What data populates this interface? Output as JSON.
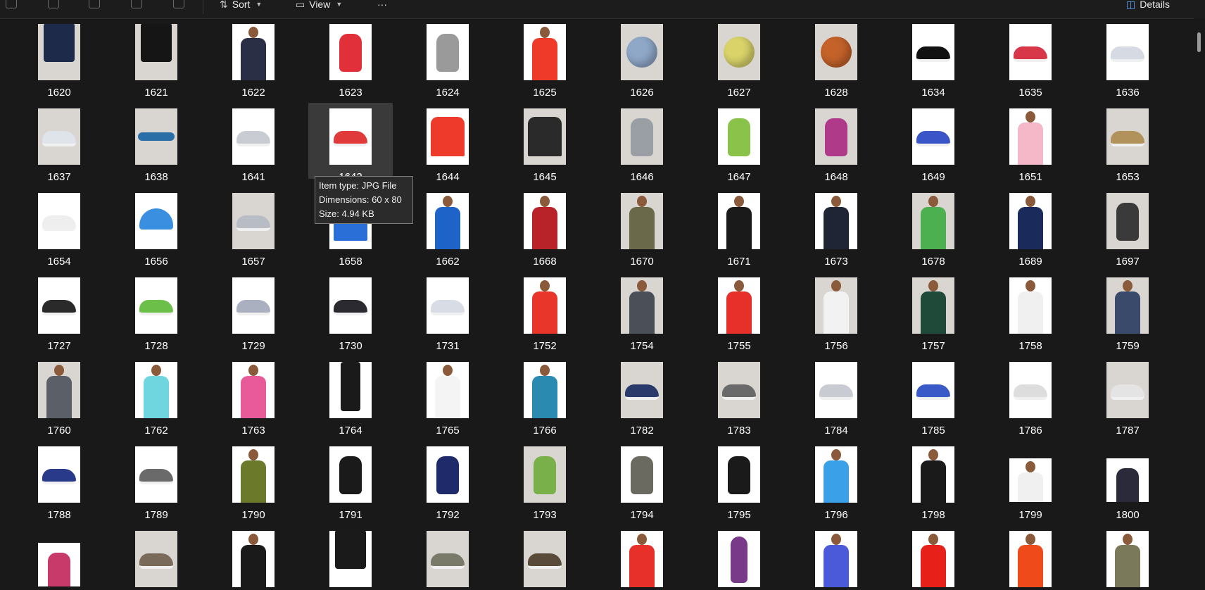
{
  "toolbar": {
    "icons": [
      "copy-icon",
      "paste-icon",
      "rename-icon",
      "share-icon",
      "delete-icon"
    ],
    "sort_label": "Sort",
    "view_label": "View",
    "more_label": "···",
    "details_label": "Details"
  },
  "tooltip": {
    "line1": "Item type: JPG File",
    "line2": "Dimensions: 60 x 80",
    "line3": "Size: 4.94 KB"
  },
  "files": [
    {
      "name": "1620",
      "kind": "shorts",
      "color": "#1d2a4a",
      "bg": "gray"
    },
    {
      "name": "1621",
      "kind": "shorts",
      "color": "#151515",
      "bg": "gray"
    },
    {
      "name": "1622",
      "kind": "person",
      "color": "#2b2f45",
      "bg": "white"
    },
    {
      "name": "1623",
      "kind": "bag",
      "color": "#e2303a",
      "bg": "white"
    },
    {
      "name": "1624",
      "kind": "bag",
      "color": "#9a9a9a",
      "bg": "white"
    },
    {
      "name": "1625",
      "kind": "person",
      "color": "#ef3a2a",
      "bg": "white"
    },
    {
      "name": "1626",
      "kind": "ball",
      "color": "#8fa8c8",
      "bg": "gray"
    },
    {
      "name": "1627",
      "kind": "ball",
      "color": "#d9d36a",
      "bg": "gray"
    },
    {
      "name": "1628",
      "kind": "ball",
      "color": "#c4622a",
      "bg": "gray"
    },
    {
      "name": "1634",
      "kind": "shoe",
      "color": "#111111",
      "bg": "white"
    },
    {
      "name": "1635",
      "kind": "shoe",
      "color": "#d8374a",
      "bg": "white"
    },
    {
      "name": "1636",
      "kind": "shoe",
      "color": "#d6dbe3",
      "bg": "white"
    },
    {
      "name": "1637",
      "kind": "shoe",
      "color": "#dfe3ea",
      "bg": "gray"
    },
    {
      "name": "1638",
      "kind": "goggles",
      "color": "#2a6ea8",
      "bg": "gray"
    },
    {
      "name": "1641",
      "kind": "shoe",
      "color": "#c9ccd2",
      "bg": "white"
    },
    {
      "name": "1642",
      "kind": "shoe",
      "color": "#e03a3a",
      "bg": "white"
    },
    {
      "name": "1644",
      "kind": "tee",
      "color": "#ee3a2a",
      "bg": "white"
    },
    {
      "name": "1645",
      "kind": "tee",
      "color": "#2a2a2a",
      "bg": "gray"
    },
    {
      "name": "1646",
      "kind": "bag",
      "color": "#9a9fa6",
      "bg": "gray"
    },
    {
      "name": "1647",
      "kind": "bag",
      "color": "#8bc34a",
      "bg": "white"
    },
    {
      "name": "1648",
      "kind": "bag",
      "color": "#b03a8a",
      "bg": "gray"
    },
    {
      "name": "1649",
      "kind": "shoe",
      "color": "#3a55c8",
      "bg": "white"
    },
    {
      "name": "1651",
      "kind": "person",
      "color": "#f4b8c8",
      "bg": "white"
    },
    {
      "name": "1653",
      "kind": "shoe",
      "color": "#b0925a",
      "bg": "gray"
    },
    {
      "name": "1654",
      "kind": "shoe",
      "color": "#eeeeee",
      "bg": "white"
    },
    {
      "name": "1656",
      "kind": "cap",
      "color": "#3a8fe0",
      "bg": "white"
    },
    {
      "name": "1657",
      "kind": "shoe",
      "color": "#b8bcc4",
      "bg": "gray"
    },
    {
      "name": "1658",
      "kind": "jacket",
      "color": "#2a6ed8",
      "bg": "white"
    },
    {
      "name": "1662",
      "kind": "person",
      "color": "#1e64c8",
      "bg": "white"
    },
    {
      "name": "1668",
      "kind": "person",
      "color": "#b8232a",
      "bg": "white"
    },
    {
      "name": "1670",
      "kind": "person",
      "color": "#6a6a4a",
      "bg": "gray"
    },
    {
      "name": "1671",
      "kind": "person",
      "color": "#1a1a1a",
      "bg": "white"
    },
    {
      "name": "1673",
      "kind": "person",
      "color": "#1f2535",
      "bg": "white"
    },
    {
      "name": "1678",
      "kind": "person",
      "color": "#4caf50",
      "bg": "gray"
    },
    {
      "name": "1689",
      "kind": "person",
      "color": "#1a2a5a",
      "bg": "white"
    },
    {
      "name": "1697",
      "kind": "bag",
      "color": "#3a3a3a",
      "bg": "gray"
    },
    {
      "name": "1727",
      "kind": "shoe",
      "color": "#2a2a2a",
      "bg": "white"
    },
    {
      "name": "1728",
      "kind": "shoe",
      "color": "#6cc04a",
      "bg": "white"
    },
    {
      "name": "1729",
      "kind": "shoe",
      "color": "#aab0c0",
      "bg": "white"
    },
    {
      "name": "1730",
      "kind": "shoe",
      "color": "#2a2a30",
      "bg": "white"
    },
    {
      "name": "1731",
      "kind": "shoe",
      "color": "#d8dde5",
      "bg": "white"
    },
    {
      "name": "1752",
      "kind": "person",
      "color": "#e8362a",
      "bg": "white"
    },
    {
      "name": "1754",
      "kind": "person",
      "color": "#4a4f58",
      "bg": "gray"
    },
    {
      "name": "1755",
      "kind": "person",
      "color": "#e8302a",
      "bg": "white"
    },
    {
      "name": "1756",
      "kind": "person",
      "color": "#f2f2f2",
      "bg": "gray"
    },
    {
      "name": "1757",
      "kind": "person",
      "color": "#1f4a3a",
      "bg": "gray"
    },
    {
      "name": "1758",
      "kind": "person",
      "color": "#f0f0f0",
      "bg": "white"
    },
    {
      "name": "1759",
      "kind": "person",
      "color": "#3a4a6a",
      "bg": "gray"
    },
    {
      "name": "1760",
      "kind": "person",
      "color": "#5a5f68",
      "bg": "gray"
    },
    {
      "name": "1762",
      "kind": "person",
      "color": "#6fd6e0",
      "bg": "white"
    },
    {
      "name": "1763",
      "kind": "person",
      "color": "#e85a9a",
      "bg": "white"
    },
    {
      "name": "1764",
      "kind": "pants",
      "color": "#1a1a1a",
      "bg": "white"
    },
    {
      "name": "1765",
      "kind": "person",
      "color": "#f4f4f4",
      "bg": "white"
    },
    {
      "name": "1766",
      "kind": "person",
      "color": "#2a8ab0",
      "bg": "white"
    },
    {
      "name": "1782",
      "kind": "shoe",
      "color": "#2a3a6a",
      "bg": "gray"
    },
    {
      "name": "1783",
      "kind": "sandal",
      "color": "#6a6a6a",
      "bg": "gray"
    },
    {
      "name": "1784",
      "kind": "shoe",
      "color": "#c8ccd2",
      "bg": "white"
    },
    {
      "name": "1785",
      "kind": "shoe",
      "color": "#3a5ac8",
      "bg": "white"
    },
    {
      "name": "1786",
      "kind": "shoe",
      "color": "#dddddd",
      "bg": "white"
    },
    {
      "name": "1787",
      "kind": "shoe",
      "color": "#e4e4e4",
      "bg": "gray"
    },
    {
      "name": "1788",
      "kind": "shoe",
      "color": "#2a3a8a",
      "bg": "white"
    },
    {
      "name": "1789",
      "kind": "shoe",
      "color": "#6a6a6a",
      "bg": "white"
    },
    {
      "name": "1790",
      "kind": "person",
      "color": "#6a7a2a",
      "bg": "white"
    },
    {
      "name": "1791",
      "kind": "bag",
      "color": "#1a1a1a",
      "bg": "white"
    },
    {
      "name": "1792",
      "kind": "bag",
      "color": "#1e2a6a",
      "bg": "white"
    },
    {
      "name": "1793",
      "kind": "bag",
      "color": "#7ab04a",
      "bg": "gray"
    },
    {
      "name": "1794",
      "kind": "bag",
      "color": "#6a6a60",
      "bg": "white"
    },
    {
      "name": "1795",
      "kind": "bag",
      "color": "#1a1a1a",
      "bg": "white"
    },
    {
      "name": "1796",
      "kind": "person",
      "color": "#3aa0e8",
      "bg": "white"
    },
    {
      "name": "1798",
      "kind": "person",
      "color": "#1a1a1a",
      "bg": "white"
    },
    {
      "name": "1799",
      "kind": "person",
      "color": "#f0f0f0",
      "bg": "white",
      "short": true
    },
    {
      "name": "1800",
      "kind": "bag",
      "color": "#2a2a3a",
      "bg": "white",
      "short": true
    },
    {
      "name": "",
      "kind": "bag",
      "color": "#c83a6a",
      "bg": "white",
      "short": true
    },
    {
      "name": "",
      "kind": "shoe",
      "color": "#7a6a5a",
      "bg": "gray"
    },
    {
      "name": "",
      "kind": "person",
      "color": "#1a1a1a",
      "bg": "white"
    },
    {
      "name": "",
      "kind": "shorts",
      "color": "#1a1a1a",
      "bg": "white"
    },
    {
      "name": "",
      "kind": "shoe",
      "color": "#7a7a6a",
      "bg": "gray"
    },
    {
      "name": "",
      "kind": "sandal",
      "color": "#5a4a3a",
      "bg": "gray"
    },
    {
      "name": "",
      "kind": "person",
      "color": "#e8302a",
      "bg": "white"
    },
    {
      "name": "",
      "kind": "bottle",
      "color": "#7a3a8a",
      "bg": "white"
    },
    {
      "name": "",
      "kind": "person",
      "color": "#4a5ad8",
      "bg": "white"
    },
    {
      "name": "",
      "kind": "person",
      "color": "#e8201a",
      "bg": "white"
    },
    {
      "name": "",
      "kind": "person",
      "color": "#ee4a1a",
      "bg": "white"
    },
    {
      "name": "",
      "kind": "person",
      "color": "#7a7a5a",
      "bg": "white"
    }
  ]
}
